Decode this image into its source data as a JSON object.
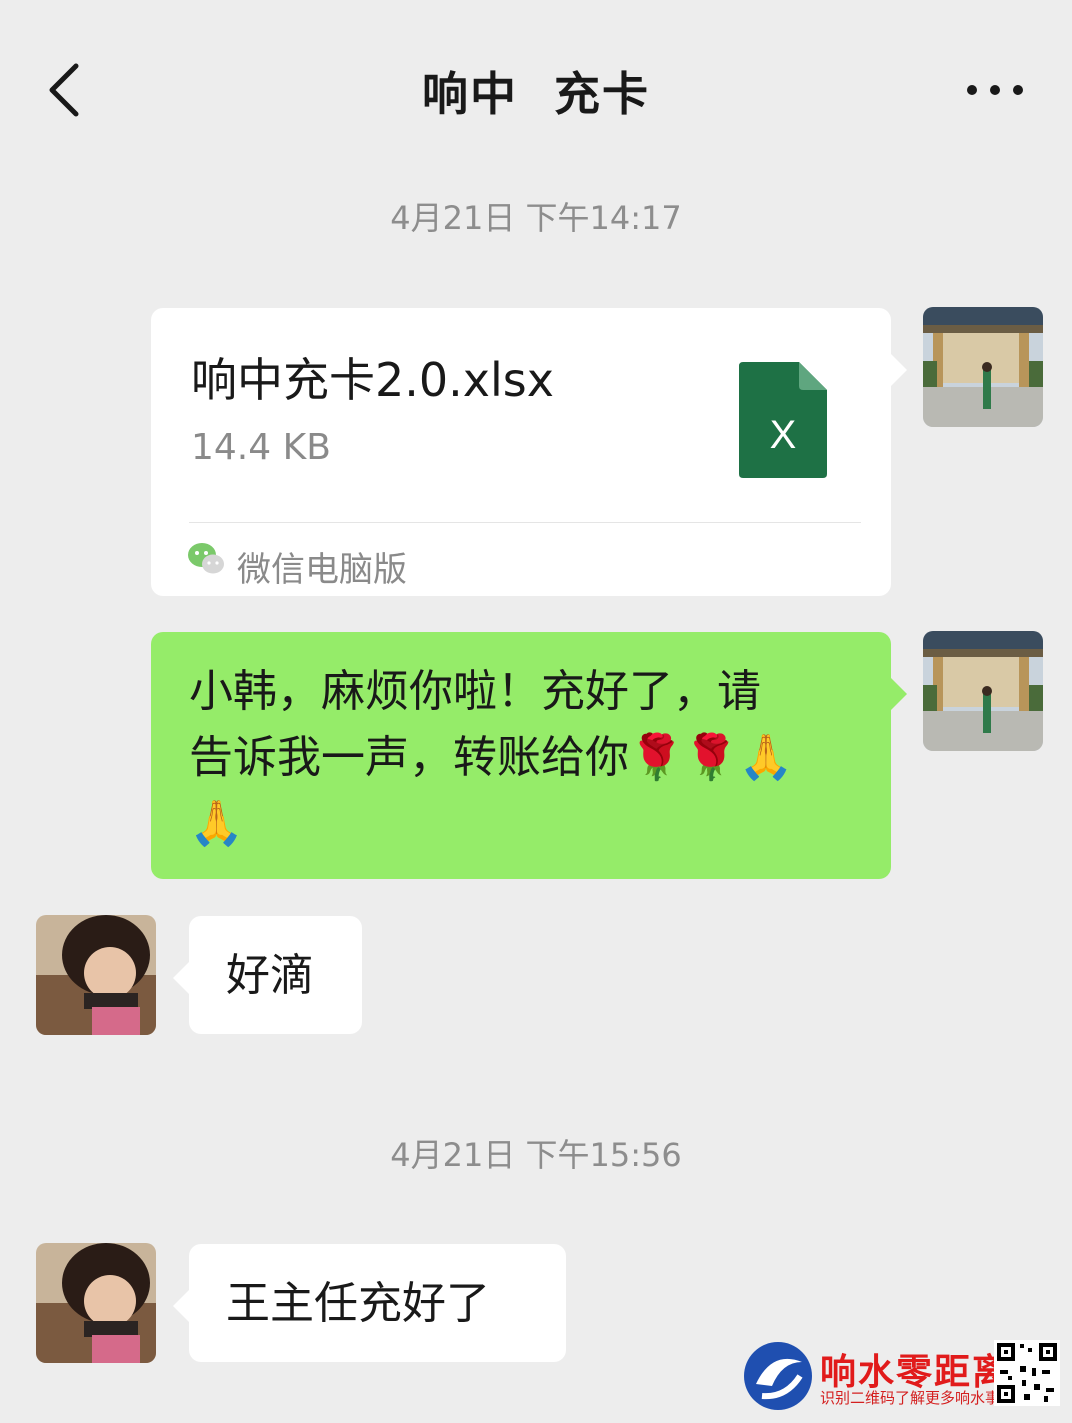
{
  "header": {
    "title": "响中  充卡",
    "back_icon": "chevron-left-icon",
    "more_icon": "more-dots-icon"
  },
  "messages": {
    "timestamp_1": "4月21日 下午14:17",
    "file": {
      "name": "响中充卡2.0.xlsx",
      "size": "14.4 KB",
      "source": "微信电脑版",
      "icon_letter": "X",
      "icon_color": "#1e7145"
    },
    "green_line1": "小韩，麻烦你啦！充好了，请",
    "green_line2": "告诉我一声，转账给你🌹🌹🙏",
    "green_line3": "🙏",
    "reply_1": "好滴",
    "timestamp_2": "4月21日 下午15:56",
    "reply_2": "王主任充好了"
  },
  "watermark": {
    "title": "响水零距离",
    "subtitle": "识别二维码了解更多响水事"
  },
  "colors": {
    "background": "#ededed",
    "bubble_green": "#95ec69",
    "bubble_white": "#ffffff",
    "timestamp": "#8d8d8d"
  }
}
